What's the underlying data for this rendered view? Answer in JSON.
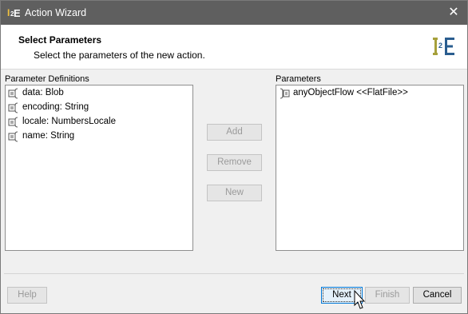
{
  "window": {
    "title": "Action Wizard",
    "close_glyph": "✕"
  },
  "header": {
    "title": "Select Parameters",
    "subtitle": "Select the parameters of the new action."
  },
  "left_panel": {
    "label": "Parameter Definitions",
    "items": [
      {
        "label": "data: Blob",
        "icon": "parameter-icon"
      },
      {
        "label": "encoding: String",
        "icon": "parameter-icon"
      },
      {
        "label": "locale: NumbersLocale",
        "icon": "parameter-icon"
      },
      {
        "label": "name: String",
        "icon": "parameter-icon"
      }
    ]
  },
  "right_panel": {
    "label": "Parameters",
    "items": [
      {
        "label": "anyObjectFlow <<FlatFile>>",
        "icon": "parameter-icon"
      }
    ]
  },
  "actions": {
    "add": "Add",
    "remove": "Remove",
    "new": "New"
  },
  "footer": {
    "help": "Help",
    "next": "Next",
    "finish": "Finish",
    "cancel": "Cancel"
  },
  "colors": {
    "titlebar": "#5f5f5f",
    "accent": "#0078d7",
    "disabled_text": "#9a9a9a"
  }
}
